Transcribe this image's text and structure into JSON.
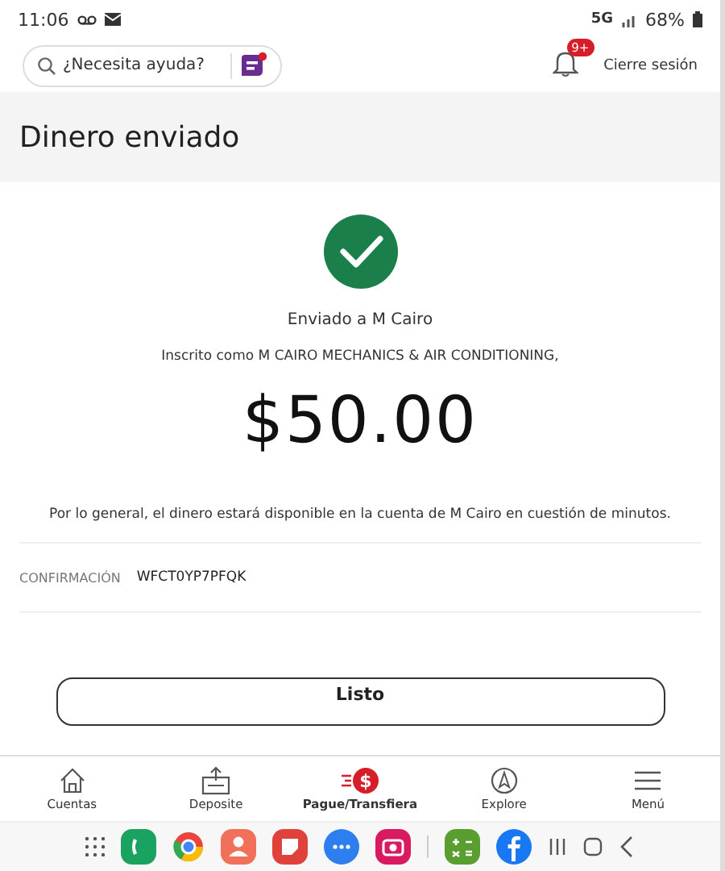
{
  "status_bar": {
    "time": "11:06",
    "network": "5G",
    "battery": "68%"
  },
  "header": {
    "search": {
      "placeholder": "¿Necesita ayuda?"
    },
    "notifications_badge": "9+",
    "logout": "Cierre sesión"
  },
  "page_title": "Dinero enviado",
  "confirmation": {
    "recipient": "Enviado a M Cairo",
    "enrolled_as": "Inscrito como M CAIRO MECHANICS & AIR CONDITIONING,",
    "amount": "$50.00",
    "note": "Por lo general, el dinero estará disponible en la cuenta de M Cairo en cuestión de minutos.",
    "code_label": "CONFIRMACIÓN",
    "code": "WFCT0YP7PFQK"
  },
  "done_button": "Listo",
  "bottom_nav": [
    {
      "kind": "home",
      "label": "Cuentas",
      "selected": false
    },
    {
      "kind": "deposit",
      "label": "Deposite",
      "selected": false
    },
    {
      "kind": "pay",
      "label": "Pague/Transfiera",
      "selected": true,
      "icon_text": "$"
    },
    {
      "kind": "explore",
      "label": "Explore",
      "selected": false
    },
    {
      "kind": "menu",
      "label": "Menú",
      "selected": false
    }
  ],
  "dock": [
    {
      "kind": "phone",
      "color": "#1aa260"
    },
    {
      "kind": "chrome",
      "color": "#e8453c"
    },
    {
      "kind": "contacts",
      "color": "#f0705a"
    },
    {
      "kind": "notes",
      "color": "#e0413a"
    },
    {
      "kind": "messages",
      "color": "#2d7ff0"
    },
    {
      "kind": "camera",
      "color": "#d81b60"
    },
    {
      "kind": "calculator",
      "color": "#5a9e2f"
    },
    {
      "kind": "facebook",
      "color": "#1877f2"
    }
  ]
}
